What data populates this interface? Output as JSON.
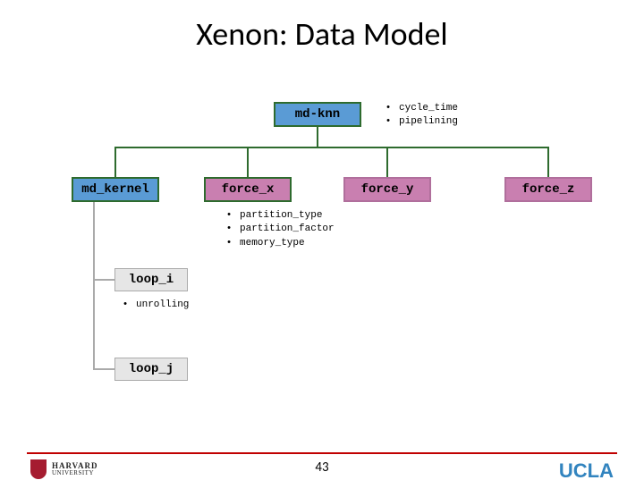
{
  "title": "Xenon: Data Model",
  "nodes": {
    "root": "md-knn",
    "md_kernel": "md_kernel",
    "force_x": "force_x",
    "force_y": "force_y",
    "force_z": "force_z",
    "loop_i": "loop_i",
    "loop_j": "loop_j"
  },
  "annotations": {
    "root": [
      "cycle_time",
      "pipelining"
    ],
    "force_x": [
      "partition_type",
      "partition_factor",
      "memory_type"
    ],
    "loop_i": [
      "unrolling"
    ]
  },
  "page": "43",
  "logos": {
    "harvard_line1": "HARVARD",
    "harvard_line2": "UNIVERSITY",
    "ucla": "UCLA"
  }
}
